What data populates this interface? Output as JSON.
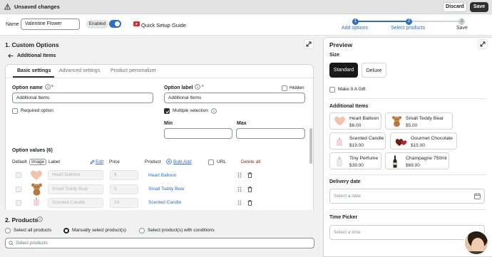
{
  "topbar": {
    "title": "Unsaved changes",
    "discard": "Discard",
    "save": "Save"
  },
  "namebar": {
    "name_label": "Name",
    "name_value": "Valentine Flower",
    "enabled": "Enabled",
    "quick_setup": "Quick Setup Guide"
  },
  "stepper": {
    "steps": [
      "Add options",
      "Select products",
      "Save"
    ],
    "numbers": [
      "1",
      "2",
      "3"
    ]
  },
  "custom_options": {
    "section_title": "1. Custom Options",
    "back_title": "Additional Items",
    "tabs": [
      "Basic settings",
      "Advanced settings",
      "Product personalizer"
    ],
    "option_name_label": "Option name",
    "option_name_value": "Additional Items",
    "option_label_label": "Option label",
    "option_label_value": "Additional Items",
    "hidden": "Hidden",
    "required_option": "Required option",
    "multiple_selection": "Multiple selection",
    "min": "Min",
    "max": "Max",
    "option_values_title": "Option values (6)",
    "columns": {
      "default": "Default",
      "image": "Image",
      "label": "Label",
      "edit": "Edit",
      "price": "Price",
      "product": "Product",
      "bulk_add": "Bulk Add",
      "url": "URL",
      "delete_all": "Delete all"
    },
    "rows": [
      {
        "label": "Heart Balloon",
        "price": "6",
        "product": "Heart Balloon"
      },
      {
        "label": "Small Teddy Bear",
        "price": "5",
        "product": "Small Teddy Bear"
      },
      {
        "label": "Scented Candle",
        "price": "19",
        "product": "Scented Candle"
      }
    ]
  },
  "products": {
    "section_title": "2. Products",
    "options": [
      "Select all products",
      "Manually select product(s)",
      "Select product(s) with conditions"
    ],
    "search_placeholder": "Select products"
  },
  "preview": {
    "title": "Preview",
    "size_label": "Size",
    "sizes": [
      "Standard",
      "Deluxe"
    ],
    "make_gift": "Make It A Gift",
    "additional_title": "Additional Items",
    "items": [
      {
        "name": "Heart Balloon",
        "price": "$6.00"
      },
      {
        "name": "Small Teddy Bear",
        "price": "$5.00"
      },
      {
        "name": "Scented Candle",
        "price": "$19.00"
      },
      {
        "name": "Gourmet Chocolate",
        "price": "$15.00"
      },
      {
        "name": "Tiny Perfume",
        "price": "$39.00"
      },
      {
        "name": "Champagne 750ml",
        "price": "$69.00"
      }
    ],
    "delivery_label": "Delivery date",
    "delivery_placeholder": "Select a date",
    "time_label": "Time Picker",
    "time_placeholder": "Select a time"
  },
  "colors": {
    "accent": "#2c6ecb",
    "dark": "#303030",
    "delete": "#8e1f0b"
  },
  "icons": [
    "warning-icon",
    "youtube-icon",
    "expand-icon",
    "back-arrow-icon",
    "info-icon",
    "drag-icon",
    "trash-icon",
    "plus-circle-icon",
    "calendar-icon",
    "search-icon"
  ]
}
